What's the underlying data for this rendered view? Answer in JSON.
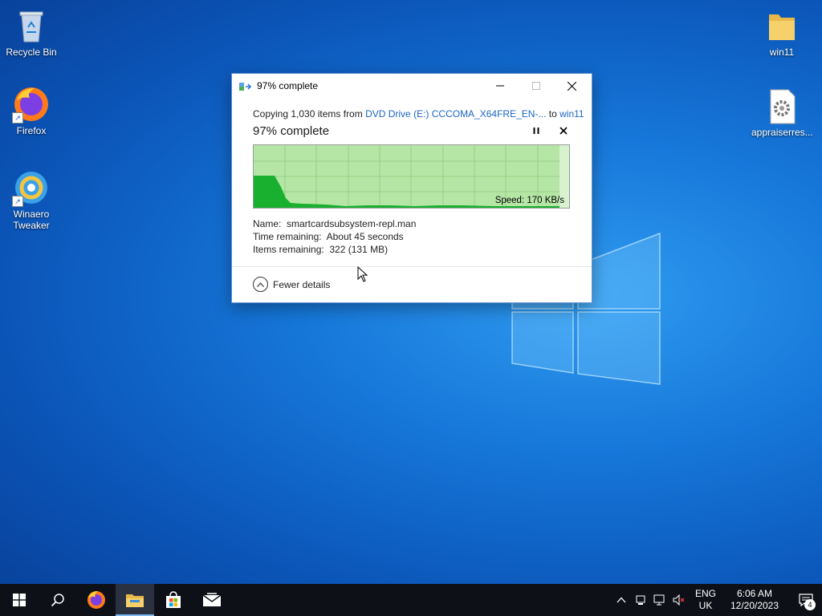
{
  "desktop": {
    "icons_left": [
      {
        "label": "Recycle Bin",
        "icon": "recycle-bin-icon"
      },
      {
        "label": "Firefox",
        "icon": "firefox-icon"
      },
      {
        "label": "Winaero Tweaker",
        "icon": "winaero-tweaker-icon"
      }
    ],
    "icons_right": [
      {
        "label": "win11",
        "icon": "folder-icon"
      },
      {
        "label": "appraiserres...",
        "icon": "settings-file-icon"
      }
    ]
  },
  "dialog": {
    "title": "97% complete",
    "copy_prefix": "Copying 1,030 items from ",
    "source": "DVD Drive (E:) CCCOMA_X64FRE_EN-...",
    "to_word": " to ",
    "destination": "win11",
    "progress_title": "97% complete",
    "progress_percent": 97,
    "speed": "Speed: 170 KB/s",
    "details": {
      "name_label": "Name:",
      "name_value": "smartcardsubsystem-repl.man",
      "time_label": "Time remaining:",
      "time_value": "About 45 seconds",
      "items_label": "Items remaining:",
      "items_value": "322 (131 MB)"
    },
    "fewer_details": "Fewer details"
  },
  "taskbar": {
    "language_top": "ENG",
    "language_bottom": "UK",
    "time": "6:06 AM",
    "date": "12/20/2023",
    "notification_count": "4"
  },
  "colors": {
    "graph_fill": "#19b02f",
    "graph_background": "#b6e6a6",
    "link": "#1c65c4",
    "taskbar": "#0d1117"
  }
}
